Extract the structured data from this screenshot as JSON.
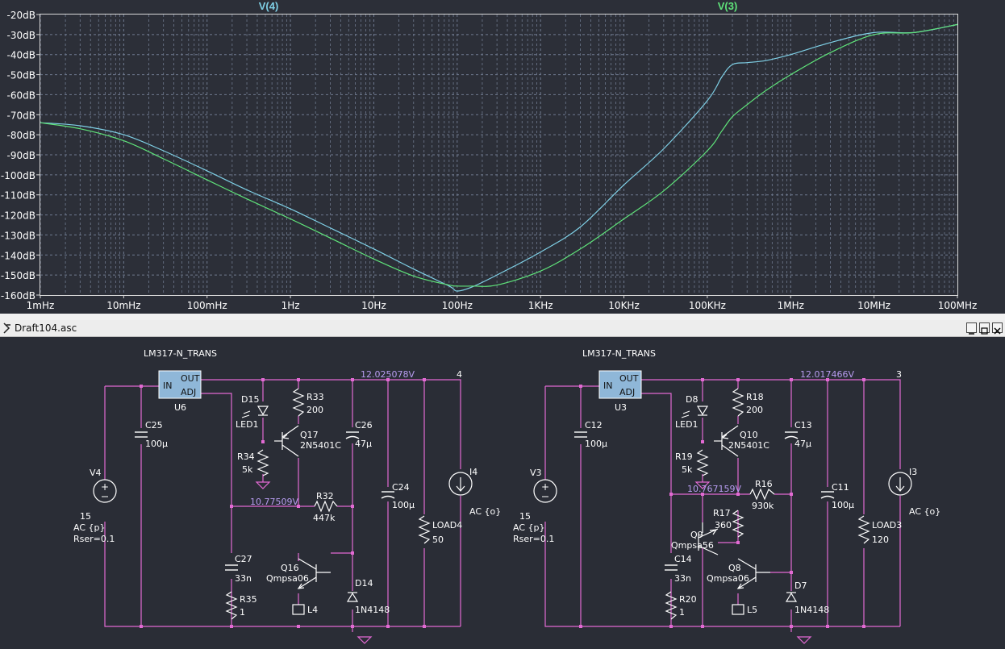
{
  "colors": {
    "plot_bg": "#2c2f38",
    "grid": "#6f7a8f",
    "trace_v4": "#7fd0e6",
    "trace_v3": "#5fe37a",
    "wire": "#e26ad3",
    "component": "#ffffff",
    "net_label": "#b79cf0"
  },
  "plot": {
    "traces": [
      {
        "name": "V(4)",
        "color": "#7fd0e6"
      },
      {
        "name": "V(3)",
        "color": "#5fe37a"
      }
    ],
    "y_ticks": [
      "-20dB",
      "-30dB",
      "-40dB",
      "-50dB",
      "-60dB",
      "-70dB",
      "-80dB",
      "-90dB",
      "-100dB",
      "-110dB",
      "-120dB",
      "-130dB",
      "-140dB",
      "-150dB",
      "-160dB"
    ],
    "x_ticks": [
      "1mHz",
      "10mHz",
      "100mHz",
      "1Hz",
      "10Hz",
      "100Hz",
      "1KHz",
      "10KHz",
      "100KHz",
      "1MHz",
      "10MHz",
      "100MHz"
    ]
  },
  "chart_data": {
    "type": "line",
    "x_scale": "log",
    "xlim": [
      "1mHz",
      "100MHz"
    ],
    "ylim": [
      -160,
      -20
    ],
    "y_unit": "dB",
    "grid": true,
    "x": [
      0.001,
      0.003,
      0.01,
      0.03,
      0.1,
      0.3,
      1,
      3,
      10,
      30,
      80,
      100,
      150,
      300,
      1000,
      3000,
      10000,
      30000,
      100000,
      150000,
      200000,
      300000,
      500000,
      1000000,
      3000000,
      10000000,
      30000000,
      100000000
    ],
    "series": [
      {
        "name": "V(4)",
        "values": [
          -74,
          -75.5,
          -80,
          -88,
          -98,
          -107.5,
          -117,
          -126.5,
          -137,
          -147,
          -155.5,
          -158,
          -156,
          -150,
          -138.5,
          -126,
          -105,
          -87,
          -63,
          -51,
          -45,
          -44,
          -43,
          -40,
          -34,
          -29,
          -29,
          -25
        ]
      },
      {
        "name": "V(3)",
        "values": [
          -74,
          -77,
          -83,
          -92,
          -102.5,
          -112,
          -122,
          -131.5,
          -142,
          -150.5,
          -155,
          -155.5,
          -155.5,
          -155,
          -148,
          -137,
          -122,
          -108,
          -88,
          -78,
          -71,
          -65,
          -58,
          -50,
          -39,
          -30,
          -29,
          -25
        ]
      }
    ]
  },
  "window": {
    "title": "Draft104.asc"
  },
  "schematic": {
    "left": {
      "regulator_name": "LM317-N_TRANS",
      "ref": "U6",
      "pin_in": "IN",
      "pin_out": "OUT",
      "pin_adj": "ADJ",
      "net_out": "12.025078V",
      "net_node": "4",
      "net_mid": "10.77509V",
      "v_src": {
        "ref": "V4",
        "value": "15",
        "ac": "AC {p}",
        "rser": "Rser=0.1"
      },
      "c25": {
        "ref": "C25",
        "value": "100µ"
      },
      "d15": {
        "ref": "D15",
        "value": "LED1"
      },
      "r33": {
        "ref": "R33",
        "value": "200"
      },
      "q17": {
        "ref": "Q17",
        "value": "2N5401C"
      },
      "r34": {
        "ref": "R34",
        "value": "5k"
      },
      "c26": {
        "ref": "C26",
        "value": "47µ"
      },
      "r32": {
        "ref": "R32",
        "value": "447k"
      },
      "c24": {
        "ref": "C24",
        "value": "100µ"
      },
      "i_src": {
        "ref": "I4",
        "value": "AC {o}"
      },
      "load": {
        "ref": "LOAD4",
        "value": "50"
      },
      "c27": {
        "ref": "C27",
        "value": "33n"
      },
      "r35": {
        "ref": "R35",
        "value": "1"
      },
      "q16": {
        "ref": "Q16",
        "value": "Qmpsa06"
      },
      "l4": {
        "ref": "L4"
      },
      "d14": {
        "ref": "D14",
        "value": "1N4148"
      }
    },
    "right": {
      "regulator_name": "LM317-N_TRANS",
      "ref": "U3",
      "pin_in": "IN",
      "pin_out": "OUT",
      "pin_adj": "ADJ",
      "net_out": "12.017466V",
      "net_node": "3",
      "net_mid": "10.767159V",
      "v_src": {
        "ref": "V3",
        "value": "15",
        "ac": "AC {p}",
        "rser": "Rser=0.1"
      },
      "c12": {
        "ref": "C12",
        "value": "100µ"
      },
      "d8": {
        "ref": "D8",
        "value": "LED1"
      },
      "r18": {
        "ref": "R18",
        "value": "200"
      },
      "q10": {
        "ref": "Q10",
        "value": "2N5401C"
      },
      "r19": {
        "ref": "R19",
        "value": "5k"
      },
      "c13": {
        "ref": "C13",
        "value": "47µ"
      },
      "r16": {
        "ref": "R16",
        "value": "930k"
      },
      "r17": {
        "ref": "R17",
        "value": "360"
      },
      "q9": {
        "ref": "Q9",
        "value": "Qmpsa56"
      },
      "c11": {
        "ref": "C11",
        "value": "100µ"
      },
      "i_src": {
        "ref": "I3",
        "value": "AC {o}"
      },
      "load": {
        "ref": "LOAD3",
        "value": "120"
      },
      "c14": {
        "ref": "C14",
        "value": "33n"
      },
      "r20": {
        "ref": "R20",
        "value": "1"
      },
      "q8": {
        "ref": "Q8",
        "value": "Qmpsa06"
      },
      "l5": {
        "ref": "L5"
      },
      "d7": {
        "ref": "D7",
        "value": "1N4148"
      }
    }
  }
}
